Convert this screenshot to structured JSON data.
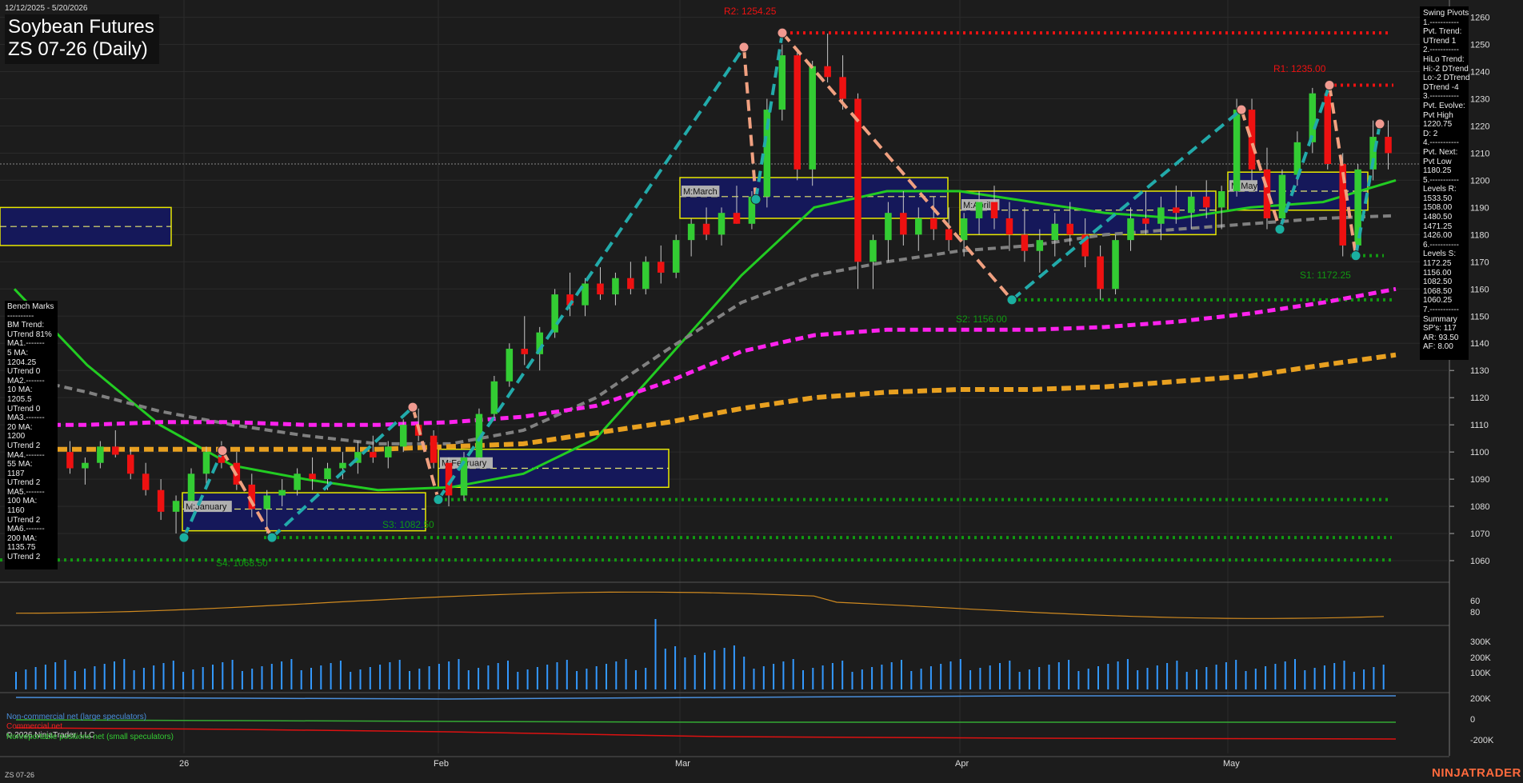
{
  "header": {
    "date_range": "12/12/2025 - 5/20/2026",
    "title": "Soybean Futures",
    "subtitle": "ZS 07-26 (Daily)"
  },
  "footer": {
    "symbol": "ZS 07-26",
    "copyright": "© 2026 NinjaTrader, LLC",
    "brand": "NINJATRADER"
  },
  "colors": {
    "background": "#1c1c1c",
    "up_candle": "#33cc33",
    "down_candle": "#ee1111",
    "ma_green": "#22cc22",
    "ma_teal": "#1aa39a",
    "ma_gray": "#808080",
    "ma_magenta": "#ff22ee",
    "ma_orange": "#e8a020",
    "resistance": "#ee1111",
    "support": "#119911",
    "swing_up": "#22aaaa",
    "swing_down": "#f0a080",
    "volume": "#3399ff",
    "oscillator": "#d08a20"
  },
  "benchmarks": {
    "lines": [
      "Bench Marks",
      "----------",
      "BM Trend:",
      "UTrend 81%",
      "MA1.-------",
      "5 MA:",
      "1204.25",
      "UTrend 0",
      "MA2.-------",
      "10 MA:",
      "1205.5",
      "UTrend 0",
      "MA3.-------",
      "20 MA:",
      "1200",
      "UTrend 2",
      "MA4.-------",
      "55 MA:",
      "1187",
      "UTrend 2",
      "MA5.-------",
      "100 MA:",
      "1160",
      "UTrend 2",
      "MA6.-------",
      "200 MA:",
      "1135.75",
      "UTrend 2"
    ]
  },
  "swing_pivots": {
    "lines": [
      "Swing Pivots",
      "1.-----------",
      "Pvt. Trend:",
      "UTrend 1",
      "2.-----------",
      "HiLo Trend:",
      "Hi:-2 DTrend",
      "Lo:-2 DTrend",
      "DTrend -4",
      "3.-----------",
      "Pvt. Evolve:",
      "Pvt High",
      "1220.75",
      "D: 2",
      "4.-----------",
      "Pvt. Next:",
      "Pvt Low",
      "1180.25",
      "5.-----------",
      "Levels R:",
      "1533.50",
      "1508.00",
      "1480.50",
      "1471.25",
      "1426.00",
      "6.-----------",
      "Levels S:",
      "1172.25",
      "1156.00",
      "1082.50",
      "1068.50",
      "1060.25",
      "7.-----------",
      "Summary",
      "SP's: 117",
      "AR: 93.50",
      "AF: 8.00"
    ]
  },
  "cot_legend": {
    "noncommercial": "Non-commercial net (large speculators)",
    "commercial": "Commercial net",
    "nonreportable": "Nonreportable positions net (small speculators)"
  },
  "chart_data": {
    "type": "candlestick",
    "price_axis": {
      "ticks": [
        1060,
        1070,
        1080,
        1090,
        1100,
        1110,
        1120,
        1130,
        1140,
        1150,
        1160,
        1170,
        1180,
        1190,
        1200,
        1210,
        1220,
        1230,
        1240,
        1250,
        1260
      ],
      "range": [
        1055,
        1264
      ]
    },
    "oscillator_axis": {
      "ticks": [
        60,
        80
      ]
    },
    "volume_axis": {
      "ticks": [
        "100K",
        "200K",
        "300K"
      ]
    },
    "cot_axis": {
      "ticks": [
        "200K",
        "0",
        "-200K"
      ]
    },
    "x_labels": [
      "26",
      "Feb",
      "Mar",
      "Apr",
      "May"
    ],
    "levels": [
      {
        "name": "R2",
        "label": "R2: 1254.25",
        "value": 1254.25,
        "kind": "resistance"
      },
      {
        "name": "R1",
        "label": "R1: 1235.00",
        "value": 1235.0,
        "kind": "resistance"
      },
      {
        "name": "S1",
        "label": "S1: 1172.25",
        "value": 1172.25,
        "kind": "support"
      },
      {
        "name": "S2",
        "label": "S2: 1156.00",
        "value": 1156.0,
        "kind": "support"
      },
      {
        "name": "S3",
        "label": "S3: 1082.50",
        "value": 1082.5,
        "kind": "support"
      },
      {
        "name": "S4",
        "label": "S4: 1068.50",
        "value": 1068.5,
        "kind": "support"
      }
    ],
    "extra_support": [
      1060.25
    ],
    "current_price_line": 1206,
    "value_areas": [
      {
        "label": "M:January",
        "hi": 1085,
        "lo": 1071,
        "mid": 1079
      },
      {
        "label": "M:February",
        "hi": 1101,
        "lo": 1087,
        "mid": 1094
      },
      {
        "label": "M:March",
        "hi": 1201,
        "lo": 1186,
        "mid": 1194
      },
      {
        "label": "M:April",
        "hi": 1196,
        "lo": 1180,
        "mid": 1189
      },
      {
        "label": "M:May",
        "hi": 1203,
        "lo": 1189,
        "mid": 1196
      },
      {
        "label": "",
        "hi": 1190,
        "lo": 1176,
        "mid": 1183
      }
    ],
    "swing_points": [
      1068.5,
      1100.5,
      1068.5,
      1116.5,
      1082.5,
      1249,
      1193,
      1254.25,
      1156,
      1226,
      1182,
      1235,
      1172.25,
      1220.75
    ],
    "ma_series": [
      {
        "period": 20,
        "values": [
          1160,
          1132,
          1110,
          1095,
          1090,
          1086,
          1087,
          1092,
          1105,
          1135,
          1165,
          1190,
          1196,
          1196,
          1192,
          1188,
          1186,
          1190,
          1192,
          1200
        ]
      },
      {
        "period": 55,
        "values": [
          1128,
          1122,
          1115,
          1110,
          1106,
          1103,
          1103,
          1108,
          1120,
          1138,
          1155,
          1165,
          1170,
          1174,
          1176,
          1180,
          1182,
          1184,
          1186,
          1187
        ]
      },
      {
        "period": 100,
        "values": [
          1110,
          1110,
          1111,
          1111,
          1110,
          1110,
          1111,
          1113,
          1117,
          1126,
          1137,
          1143,
          1145,
          1145,
          1145,
          1146,
          1148,
          1151,
          1155,
          1160
        ]
      },
      {
        "period": 200,
        "values": [
          1101,
          1101,
          1101,
          1101,
          1101,
          1101,
          1102,
          1103,
          1107,
          1111,
          1116,
          1120,
          1122,
          1123,
          1123,
          1124,
          1126,
          1128,
          1132,
          1135.75
        ]
      }
    ],
    "candles": [
      [
        1100,
        1104,
        1092,
        1094
      ],
      [
        1094,
        1098,
        1088,
        1096
      ],
      [
        1096,
        1104,
        1094,
        1102
      ],
      [
        1102,
        1108,
        1098,
        1099
      ],
      [
        1099,
        1101,
        1090,
        1092
      ],
      [
        1092,
        1096,
        1084,
        1086
      ],
      [
        1086,
        1090,
        1075,
        1078
      ],
      [
        1078,
        1084,
        1070,
        1082
      ],
      [
        1082,
        1094,
        1080,
        1092
      ],
      [
        1092,
        1102,
        1088,
        1100
      ],
      [
        1100,
        1104,
        1094,
        1096
      ],
      [
        1096,
        1100,
        1086,
        1088
      ],
      [
        1088,
        1092,
        1076,
        1079
      ],
      [
        1079,
        1086,
        1070,
        1084
      ],
      [
        1084,
        1090,
        1080,
        1086
      ],
      [
        1086,
        1094,
        1084,
        1092
      ],
      [
        1092,
        1098,
        1086,
        1090
      ],
      [
        1090,
        1096,
        1086,
        1094
      ],
      [
        1094,
        1100,
        1090,
        1096
      ],
      [
        1096,
        1104,
        1092,
        1100
      ],
      [
        1100,
        1106,
        1096,
        1098
      ],
      [
        1098,
        1104,
        1094,
        1102
      ],
      [
        1102,
        1112,
        1100,
        1110
      ],
      [
        1110,
        1116,
        1104,
        1106
      ],
      [
        1106,
        1108,
        1094,
        1096
      ],
      [
        1096,
        1098,
        1080,
        1084
      ],
      [
        1084,
        1100,
        1082,
        1098
      ],
      [
        1098,
        1116,
        1096,
        1114
      ],
      [
        1114,
        1128,
        1112,
        1126
      ],
      [
        1126,
        1140,
        1124,
        1138
      ],
      [
        1138,
        1150,
        1132,
        1136
      ],
      [
        1136,
        1146,
        1130,
        1144
      ],
      [
        1144,
        1160,
        1142,
        1158
      ],
      [
        1158,
        1166,
        1150,
        1154
      ],
      [
        1154,
        1164,
        1150,
        1162
      ],
      [
        1162,
        1168,
        1156,
        1158
      ],
      [
        1158,
        1166,
        1154,
        1164
      ],
      [
        1164,
        1170,
        1158,
        1160
      ],
      [
        1160,
        1172,
        1158,
        1170
      ],
      [
        1170,
        1176,
        1162,
        1166
      ],
      [
        1166,
        1180,
        1164,
        1178
      ],
      [
        1178,
        1186,
        1172,
        1184
      ],
      [
        1184,
        1190,
        1178,
        1180
      ],
      [
        1180,
        1190,
        1176,
        1188
      ],
      [
        1188,
        1198,
        1184,
        1184
      ],
      [
        1184,
        1196,
        1182,
        1194
      ],
      [
        1194,
        1230,
        1190,
        1226
      ],
      [
        1226,
        1250,
        1222,
        1246
      ],
      [
        1246,
        1248,
        1200,
        1204
      ],
      [
        1204,
        1244,
        1198,
        1242
      ],
      [
        1242,
        1254,
        1236,
        1238
      ],
      [
        1238,
        1246,
        1226,
        1230
      ],
      [
        1230,
        1232,
        1160,
        1170
      ],
      [
        1170,
        1180,
        1160,
        1178
      ],
      [
        1178,
        1192,
        1170,
        1188
      ],
      [
        1188,
        1196,
        1176,
        1180
      ],
      [
        1180,
        1190,
        1174,
        1186
      ],
      [
        1186,
        1194,
        1178,
        1182
      ],
      [
        1182,
        1190,
        1174,
        1178
      ],
      [
        1178,
        1188,
        1172,
        1186
      ],
      [
        1186,
        1196,
        1180,
        1192
      ],
      [
        1192,
        1198,
        1182,
        1186
      ],
      [
        1186,
        1192,
        1174,
        1180
      ],
      [
        1180,
        1190,
        1170,
        1174
      ],
      [
        1174,
        1182,
        1166,
        1178
      ],
      [
        1178,
        1188,
        1172,
        1184
      ],
      [
        1184,
        1192,
        1176,
        1180
      ],
      [
        1180,
        1186,
        1168,
        1172
      ],
      [
        1172,
        1176,
        1156,
        1160
      ],
      [
        1160,
        1180,
        1158,
        1178
      ],
      [
        1178,
        1190,
        1174,
        1186
      ],
      [
        1186,
        1196,
        1180,
        1184
      ],
      [
        1184,
        1194,
        1178,
        1190
      ],
      [
        1190,
        1198,
        1184,
        1188
      ],
      [
        1188,
        1196,
        1182,
        1194
      ],
      [
        1194,
        1200,
        1186,
        1190
      ],
      [
        1190,
        1198,
        1182,
        1196
      ],
      [
        1196,
        1230,
        1194,
        1226
      ],
      [
        1226,
        1230,
        1200,
        1204
      ],
      [
        1204,
        1212,
        1182,
        1186
      ],
      [
        1186,
        1204,
        1182,
        1202
      ],
      [
        1202,
        1218,
        1198,
        1214
      ],
      [
        1214,
        1234,
        1210,
        1232
      ],
      [
        1232,
        1234,
        1204,
        1206
      ],
      [
        1206,
        1210,
        1172,
        1176
      ],
      [
        1176,
        1206,
        1172,
        1204
      ],
      [
        1204,
        1222,
        1200,
        1216
      ],
      [
        1216,
        1222,
        1204,
        1210
      ]
    ]
  }
}
